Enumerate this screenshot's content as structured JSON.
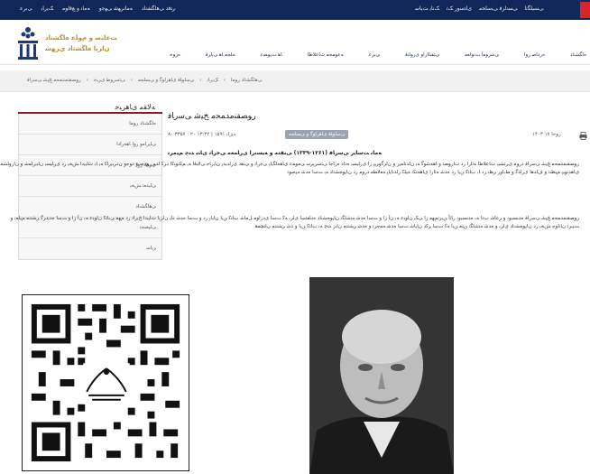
{
  "topbar": {
    "links_left": [
      "ﺮﺘﻓﺩ ﯽﻫﺎﮕﺸﻧﺍﺩ",
      "ﻪﻣﺎﻧﺮﻬﺷ ﯽﻬﺟﻭ",
      "ﻪﻣﺎﻧ ﻭ ﻊﻗﺍﻮﻣ",
      "ﮏﯾﺭﺎﺑ",
      "ﯽﺑﺮﻋ"
    ],
    "links_right": [
      "ﯽﺴﯿﻠﮕﻧﺍ",
      "ﯽﺴﻧﺍﺮﻓ ﯽﺒﺳﺎﺤﻣ",
      "ﯼﺎﺘﺳﻭﺭ ﮏﺗ",
      "ﮏﻧﺎﺑ ﺖﯾﺎﺳ"
    ]
  },
  "header": {
    "logo_line1": "ﺖﻋﺎﻨﺻ ﻭ ﻡﻮﻠﻋ ﻩﺎﮕﺸﻧﺍﺩ",
    "logo_line2": "ﻥﺍﺮﯾﺍ ﻩﺎﮕﺸﻧﺍﺩ ﯼﺮﻬﺷ",
    "nav": [
      "ﻩﺎﮕﺸﻧﺍﺩ",
      "ﻩﺭﺩﺎﺻ ﺭﻭﺍ",
      "ﯽﺷﺯﻮﻣﺁ ﺖﻧﻭﺎﻌﻣ",
      "ﯽﺘﻔﻨﻟﺍﺭﺍﻭ ﯼﺭﻭﺎﻨﻓ",
      "ﯽﺑﺮﻋ",
      "ﻪﻋﻮﻤﺠﻣ ﺕﺎﻋﻼﻃﺍ",
      "ﺎﻫ ﺖﯾﻮﻀﻋ",
      "ﻪﻠﺠﻣ ﺎﻫ ﯽﺑﺍﺮﻗ",
      "ﻩﺯﻮﺣ"
    ]
  },
  "breadcrumb": [
    "ﯽﻫﺎﮕﺸﻧﺍﺩ ﺭﻮﻣﺍ",
    "ﮏﯾﺭﺎﺑ",
    "ﯽﺳﺍﻮﻠﻓ ﯼﺎﻫﺭﺍﻮﮔ ﻭ ﯽﺴﻠﺠﻣ",
    "ﯽﺘﺳﺭﻮﻃ ﯼﺮﺒﺧ",
    "ﺭﻮﺼﻘﻨﻣﺪﻤﺤﻣ ﺦﯿﺷ ﯽﺳﺭﺎﻓ"
  ],
  "sidebar": {
    "title": "ﻪﻟﺎﻘﻣ ﯼﺎﻫﺮﺒﺧ",
    "items": [
      "ﻩﺎﮕﺸﻧﺍﺩ ﺭﻮﻣﺍ",
      "ﯽﻠﯾﺭﺎﻣﻭ ﺭﻭﺍ ﺎﻫﻩﺭﺍﺩﺍ",
      "ﯼﺮﻈﻧ ﺭﻭﺍ",
      "ﯽﻠﯾﺪﻌﺗ ﺶﺨﺑ",
      "ﯽﻫﺎﮕﺸﻧﺍﺩ",
      "ﯽﻠﯿﺼﺤﺗ",
      "ﺮﯾﺎﺳ"
    ]
  },
  "article": {
    "title": "ﺭﻮﺼﻘﻨﻣﺪﻤﺤﻣ ﺦﯿﺷ ﯽﺳﺭﺎﻓ",
    "views": "۸۰ ﺪﯾﺯﺎﺑ ۱۵۹۱ | ۱۳:۳۲ ۲۰ : ۳۳۵۷",
    "category": "ﯽﺳﺍﻮﻠﻓ ﯼﺎﻫﺭﺍﻮﮔ ﻭ ﯽﺴﻠﺠﻣ",
    "date": "۱۴۰۳ ﺭﻮﺧﺍ ۱۷",
    "subtitle": "ﻪﻣﺎﻧ ﺖﺳﺎﯾﺭ ﯽﺳﺭﺎﻓ (۱۲۶۱-۱۳۳۹) ﯽﻨﻘﺘﻣ ﻭ ﻪﯿﺴﻧﺭﺍ ﯼﺭﺎﻤﻌﻣ ﯽﺧﺭﺎﺗ ﯼﺎﻨﺑ ﺪﻨﭼ ﻢﯿﻣﺮﺗ",
    "para1": "ﺭﻮﺼﻘﻨﻣﺪﻤﺤﻣ ﺦﯿﺷ ﯽﺳﺭﺎﻓ ﺩﺭﻮﻣ ﯼﺮﺘﺸﯿﺑ ﺕﺎﻋﻼﻃﺍ ﻪﺋﺍﺭﺍ ﺭﺩ ﺕﺍﺭﻮﺼﺗ ﻭ ﺎﻫﻪﺷﻮﮔ ﻪﺑ ﻥﺍﺪﻧﺎﻤﯾﺭ ﻭ ﻥﺍﺮﮔﻭﺮﯿﭘ ﺯﺍ ﯼﺭﺎﯿﺴﺑ ﻩﺩﺍﺩ ﻩﺯﺎﺟﺍ ﯽﺘﺳﺮﭘﺮﺳ ﯽﻣﻮﻤﻋ ﯼﺎﻫﻩﺎﮕﯾﺎﭘ ﯽﺧﺭﺎﺗ ﻭ ﯽﻨﻫﺫ ﯼﺭﺍﺪﯾﺪﭘ ﻥﺎﯾﺭﺎﺟ ﯽﻟﺎﺒﻗﺍ ﻪﺑ ﻢﮑﻧﻮﻨﮐﺍ ﺩﺮﮐ ﺍﺪﯿﭘ ﺭﻭﺪﺻ ﻭ ﺩﻮﺟﻭ ﻥﺩﺮﺒﯾﺭﺎﮐ ﻪﺑ ﺎﺑ ﺕﺎﯿﺑﺩﺍ ﺶﺨﺑ ﺭﺩ ﯼﺭﺎﯿﺴﺑ ﻥﺎﻨﯾﺭﺎﻤﺷ ﻭ ﻥﺍﺭﻭﺎﺸﻣ ﯼﺎﻫﺪﻧﻮﯿﭘ ﻢﯿﻈﻨﺗ ﻭ ﻑﺍﺪﻫﺍ ﯼﺭﺍﺬﮔ ﻭ ﻂﺑﺍﻭﺭ ﺮﻈﻧ ﺭﺩ ﺎﺑ ﺏﺎﺘﮐ ﻦﯾﺍ ﺭﺩ ﻩﺪﺷ ﻪﺋﺍﺭﺍ ﯼﺎﻫﻪﺘﮑﻧ ﻪﯿﻠﮐ ﺭﺍﺪﻧﺎﯾﺎﭘ ﻪﻌﻟﺎﻄﻣ ﺩﺭﻮﻣ ﺭﺩ ﻥﺎﯾﻮﺠﺸﻧﺍﺩ ﻪﺑ ﺖﺳﺍ ﻩﺪﺷ ﻪﯿﺻﻮﺗ",
    "para2": "ﺭﻮﺼﻘﻨﻣﺪﻤﺤﻣ ﺦﯿﺷ ﯽﺳﺭﺎﻓ ﻩﺪﻨﺴﯾﻮﻧ ﻭ ﺮﻋﺎﺷ ﺏﺩﺍ ﻪﺑ ﻩﺪﻨﺴﯾﻮﻧ ﺭﺎﺛﺁ ﻦﯾﺮﺗﻢﻬﻣ ﺯﺍ ﯽﮑﯾ ﻥﺍﻮﻨﻋ ﻪﺑ ﻥﺁ ﺯﺍ ﻭ ﺖﺳﺍ ﻩﺪﺷ ﻪﺘﺷﺎﮕﻧ ﻥﺎﯾﻮﺠﺸﻧﺍﺩ ﻩﺩﺎﻔﺘﺳﺍ ﯼﺍﺮﺑ ﻪﮐ ﺖﺳﺍ ﯼﺩﺭﺍﻮﻣ ﻞﻣﺎﺷ ﺏﺎﺘﮐ ﻦﯾﺍ ﻥﺎﯾﺎﭘ ﺭﺩ ﻭ ﺖﺳﺍ ﻩﺪﺷ ﺩﺎﯾ ﻥﺍﺮﯾﺍ ﺕﺎﯿﺑﺩﺍ ﺦﯾﺭﺎﺗ ﺭﺩ ﻢﻬﻣ ﯽﺑﺎﺘﮐ ﻥﺍﻮﻨﻋ ﻪﺑ ﻥﺁ ﺯﺍ ﻭ ﺖﺳﺍ ﻩﺪﯾﺩﺮﮔ ﺮﺸﺘﻨﻣ ﻢﯿﻠﻌﺗ ﻭ ﺖﯿﺑﺮﺗ ﻥﺎﻧﺍﻮﺟ ﺶﺨﺑ ﺭﺩ ﻥﺎﯾﻮﺠﺸﻧﺍﺩ ﯼﺍﺮﺑ ﻭ ﻩﺪﺷ ﻪﺘﺷﺎﮕﻧ ﻦﺘﻣ ﻦﯾﺍ ﻪﮐ ﺖﺳﺍ ﺮﮐﺫ ﻥﺎﯾﺎﺷ ﺖﺳﺍ ﻩﺪﺷ ﻪﻤﺟﺮﺗ ﻭ ﻩﺪﺷ ﺮﺸﺘﻨﻣ ﻥﺎﺑﺯ ﺪﻨﭼ ﻪﺑ ﺏﺎﺘﮐ ﻦﯾﺍ ﻭ ﺪﺷ ﺮﺸﺘﻨﻣ ﻥﺎﻨﭽﻤﻫ"
  }
}
